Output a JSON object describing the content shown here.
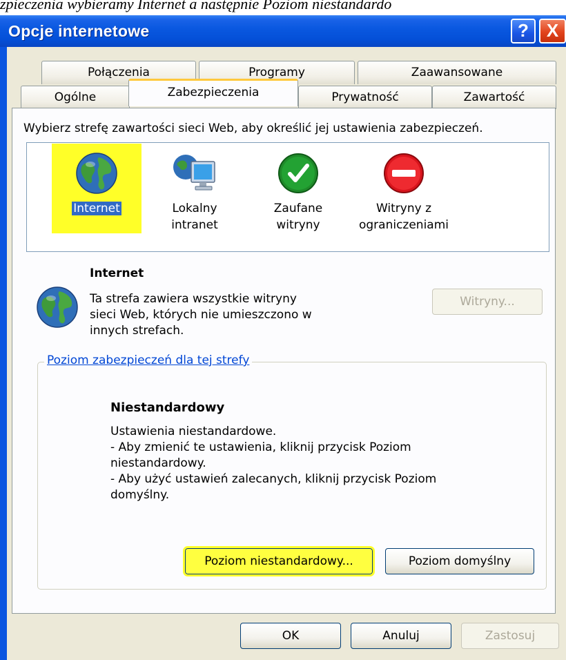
{
  "caption_fragment": "zpieczenia wybieramy Internet a następnie Poziom niestandardo",
  "window": {
    "title": "Opcje internetowe",
    "help_label": "?",
    "close_label": "X"
  },
  "tabs_row1": [
    "Połączenia",
    "Programy",
    "Zaawansowane"
  ],
  "tabs_row2": [
    "Ogólne",
    "Zabezpieczenia",
    "Prywatność",
    "Zawartość"
  ],
  "active_tab": "Zabezpieczenia",
  "instruction": "Wybierz strefę zawartości sieci Web, aby określić jej ustawienia zabezpieczeń.",
  "zones": [
    {
      "label": "Internet",
      "icon": "globe-icon",
      "selected": true
    },
    {
      "label": "Lokalny\nintranet",
      "icon": "local-intranet-icon",
      "selected": false
    },
    {
      "label": "Zaufane\nwitryny",
      "icon": "trusted-check-icon",
      "selected": false
    },
    {
      "label": "Witryny z\nograniczeniami",
      "icon": "restricted-icon",
      "selected": false
    }
  ],
  "zone_info": {
    "title": "Internet",
    "description": "Ta strefa zawiera wszystkie witryny\nsieci Web, których nie umieszczono w\ninnych strefach.",
    "sites_button": "Witryny..."
  },
  "security_level": {
    "group_title": "Poziom zabezpieczeń dla tej strefy",
    "level_name": "Niestandardowy",
    "lines": [
      "Ustawienia niestandardowe.",
      "- Aby zmienić te ustawienia, kliknij przycisk Poziom",
      "niestandardowy.",
      "- Aby użyć ustawień zalecanych, kliknij przycisk Poziom",
      "domyślny."
    ],
    "custom_button": "Poziom niestandardowy...",
    "default_button": "Poziom domyślny"
  },
  "footer": {
    "ok": "OK",
    "cancel": "Anuluj",
    "apply": "Zastosuj"
  },
  "colors": {
    "title_bar": "#0a58e0",
    "dialog_bg": "#ece9d8",
    "highlight": "#ffff28",
    "selection": "#316ac5",
    "group_title": "#0046d5"
  }
}
